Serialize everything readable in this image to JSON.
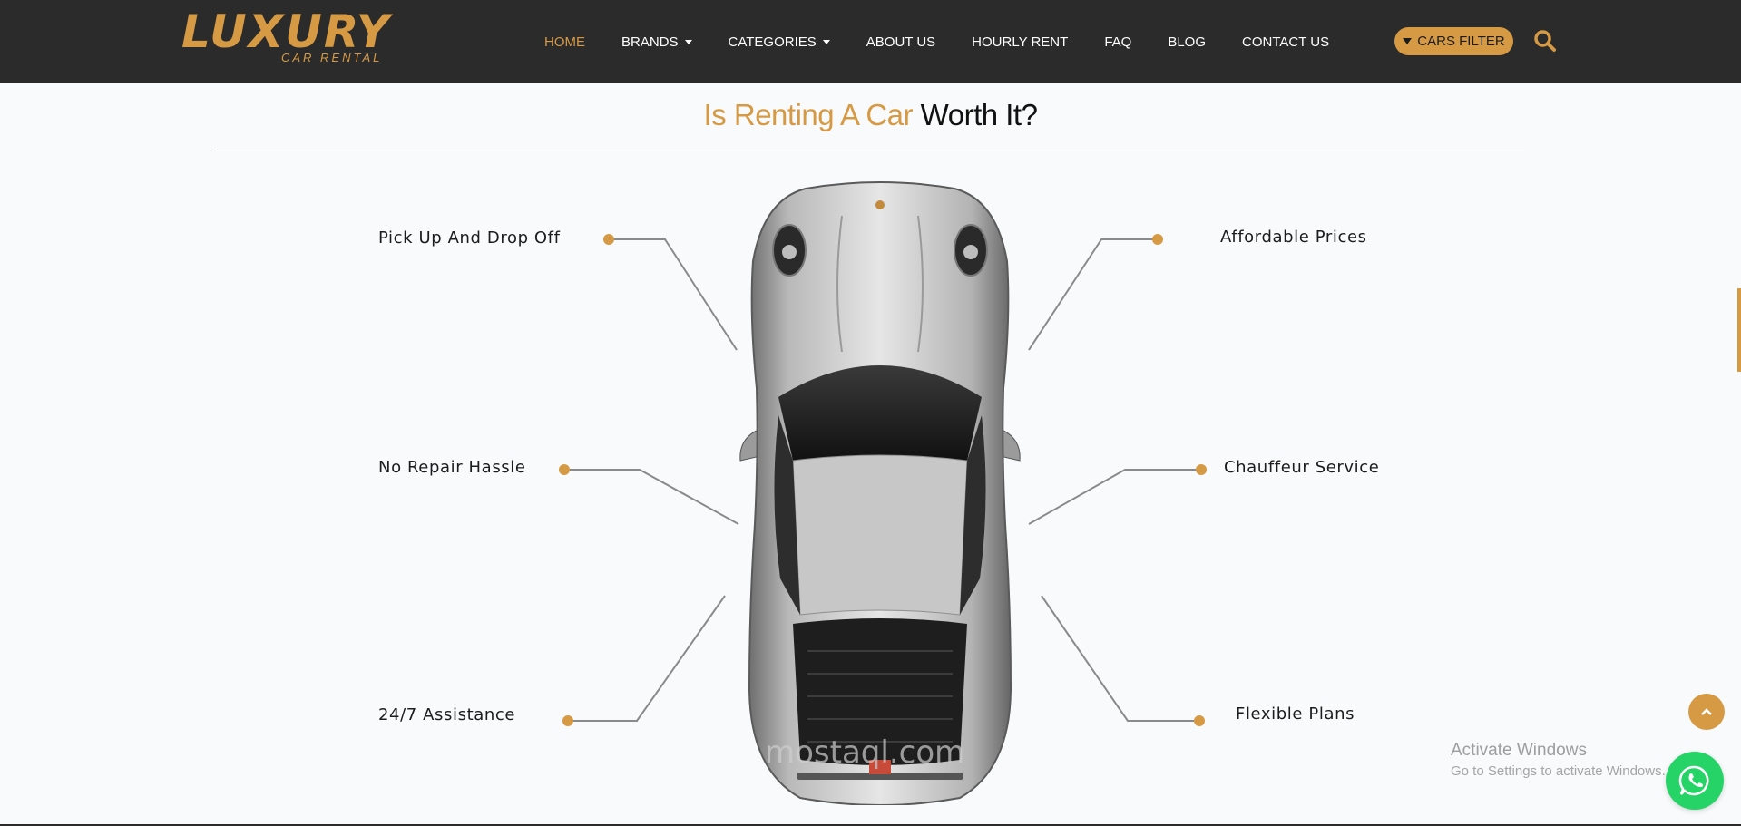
{
  "navbar": {
    "logo": {
      "main": "LUXURY",
      "sub": "CAR RENTAL"
    },
    "items": [
      {
        "label": "HOME",
        "active": true,
        "dropdown": false
      },
      {
        "label": "BRANDS",
        "active": false,
        "dropdown": true
      },
      {
        "label": "CATEGORIES",
        "active": false,
        "dropdown": true
      },
      {
        "label": "ABOUT US",
        "active": false,
        "dropdown": false
      },
      {
        "label": "HOURLY RENT",
        "active": false,
        "dropdown": false
      },
      {
        "label": "FAQ",
        "active": false,
        "dropdown": false
      },
      {
        "label": "BLOG",
        "active": false,
        "dropdown": false
      },
      {
        "label": "CONTACT US",
        "active": false,
        "dropdown": false
      }
    ],
    "filter_label": "CARS FILTER"
  },
  "section": {
    "title_accent": "Is Renting A Car",
    "title_rest": "Worth It?",
    "features": {
      "left_top": "Pick Up And Drop Off",
      "left_mid": "No Repair Hassle",
      "left_bottom": "24/7 Assistance",
      "right_top": "Affordable Prices",
      "right_mid": "Chauffeur Service",
      "right_bottom": "Flexible Plans"
    }
  },
  "watermark": "mostaql.com",
  "windows_notice": {
    "title": "Activate Windows",
    "subtitle": "Go to Settings to activate Windows."
  },
  "colors": {
    "accent": "#d69a45",
    "navbar_bg": "#2b2b2b",
    "page_bg": "#f8fafc",
    "whatsapp": "#25d366"
  },
  "icons": [
    "filter-icon",
    "search-icon",
    "chevron-up-icon",
    "whatsapp-icon",
    "car-image"
  ]
}
